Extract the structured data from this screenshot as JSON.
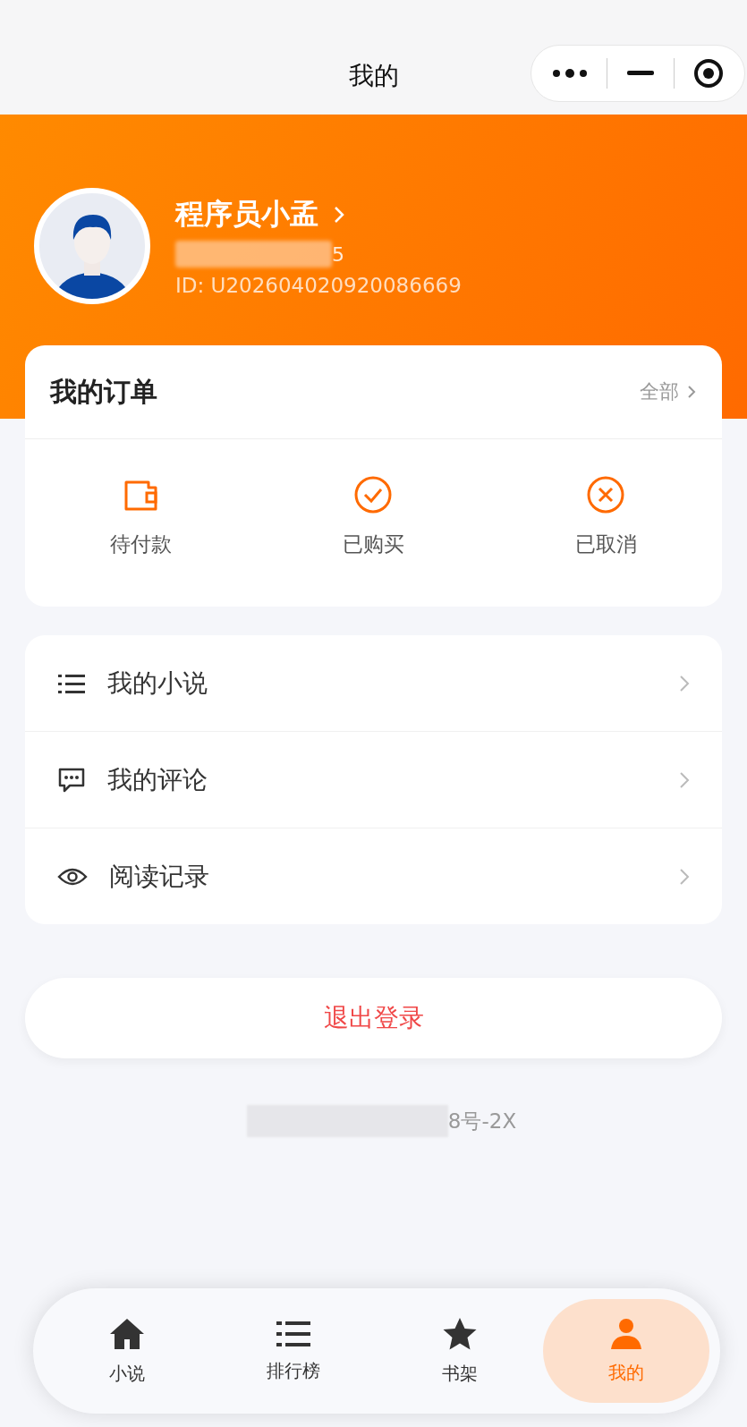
{
  "nav_bar": {
    "title": "我的"
  },
  "profile": {
    "name": "程序员小孟",
    "phone_tail": "5",
    "user_id": "ID: U202604020920086669"
  },
  "orders": {
    "title": "我的订单",
    "all_link": "全部",
    "items": [
      {
        "kind": "wallet",
        "label": "待付款"
      },
      {
        "kind": "check",
        "label": "已购买"
      },
      {
        "kind": "cancel",
        "label": "已取消"
      }
    ]
  },
  "menu": [
    {
      "kind": "list",
      "label": "我的小说"
    },
    {
      "kind": "comment",
      "label": "我的评论"
    },
    {
      "kind": "eye",
      "label": "阅读记录"
    }
  ],
  "logout_button": "退出登录",
  "footer": "8号-2X",
  "tab_bar": [
    {
      "kind": "home",
      "label": "小说",
      "selected": false
    },
    {
      "kind": "list",
      "label": "排行榜",
      "selected": false
    },
    {
      "kind": "star",
      "label": "书架",
      "selected": false
    },
    {
      "kind": "user",
      "label": "我的",
      "selected": true
    }
  ]
}
